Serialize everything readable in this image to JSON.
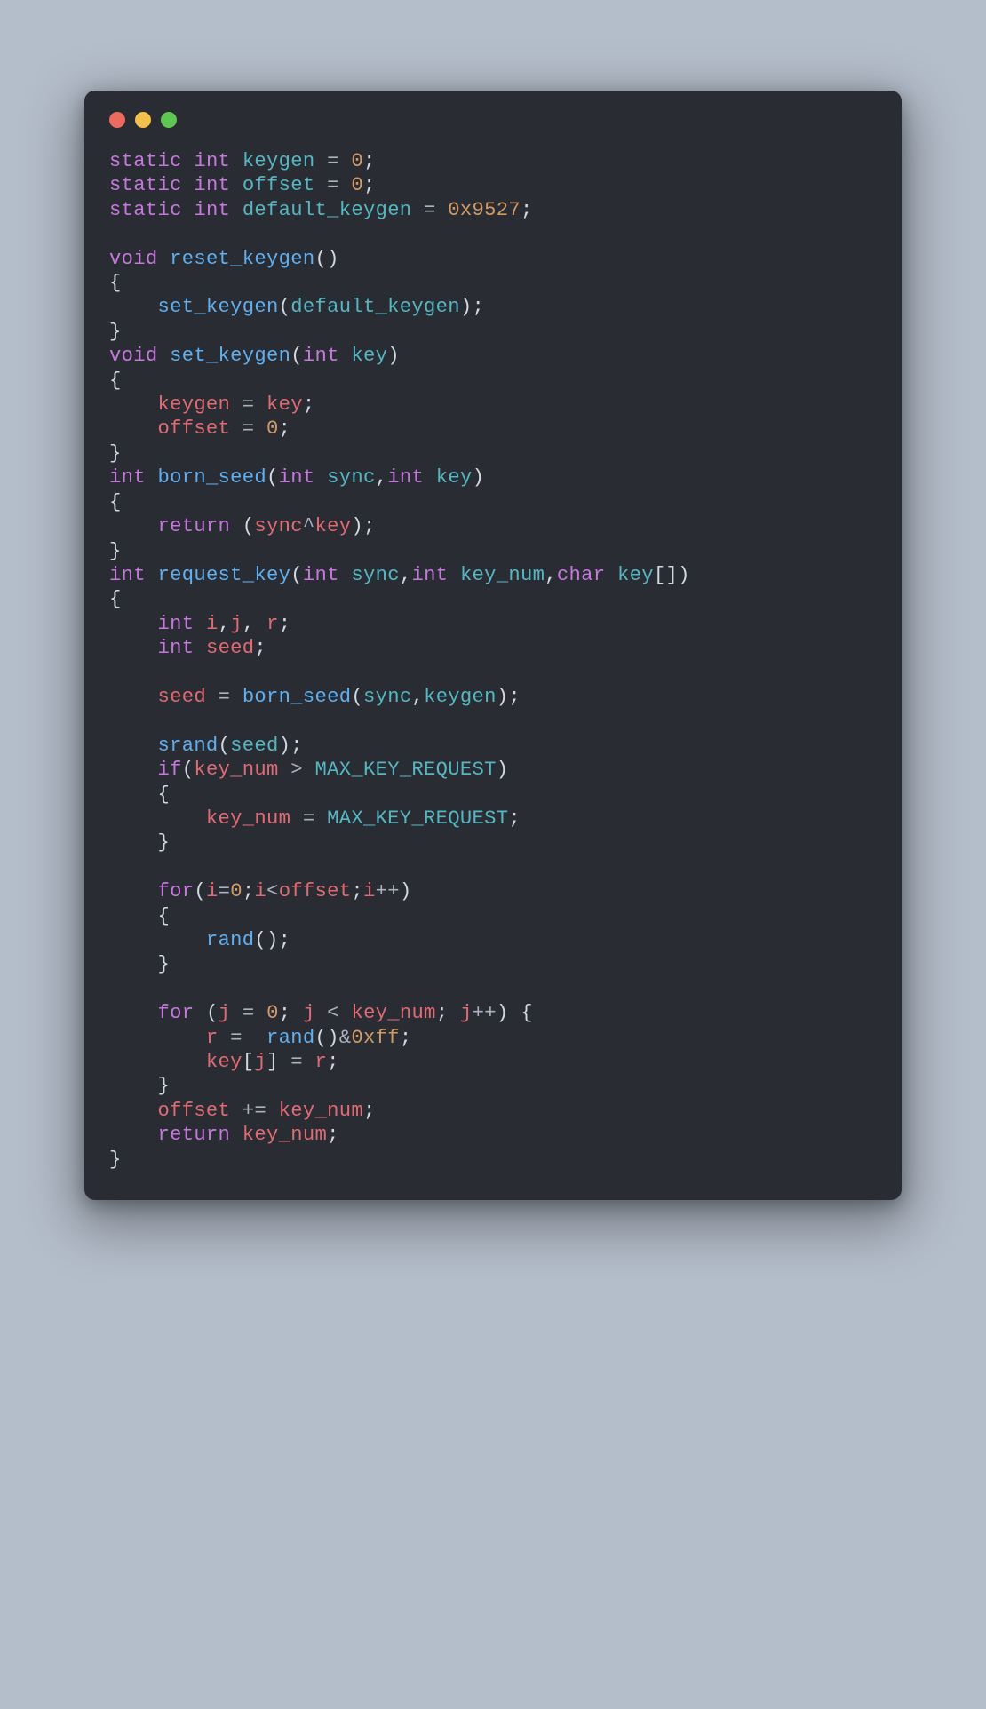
{
  "kw": {
    "static": "static",
    "int": "int",
    "void": "void",
    "return": "return",
    "if": "if",
    "for": "for",
    "char": "char"
  },
  "id": {
    "keygen": "keygen",
    "offset": "offset",
    "default_keygen": "default_keygen",
    "key": "key",
    "sync": "sync",
    "key_num": "key_num",
    "i": "i",
    "j": "j",
    "r": "r",
    "seed": "seed",
    "MAX_KEY_REQUEST": "MAX_KEY_REQUEST"
  },
  "fn": {
    "reset_keygen": "reset_keygen",
    "set_keygen": "set_keygen",
    "born_seed": "born_seed",
    "request_key": "request_key",
    "srand": "srand",
    "rand": "rand"
  },
  "num": {
    "zero": "0",
    "hex9527": "0x9527",
    "hexff": "0xff"
  },
  "sym": {
    "eq": "=",
    "semi": ";",
    "lparen": "(",
    "rparen": ")",
    "lbrace": "{",
    "rbrace": "}",
    "lbrack": "[",
    "rbrack": "]",
    "comma": ",",
    "caret": "^",
    "gt": ">",
    "lt": "<",
    "amp": "&",
    "inc": "++",
    "pluseq": "+="
  }
}
